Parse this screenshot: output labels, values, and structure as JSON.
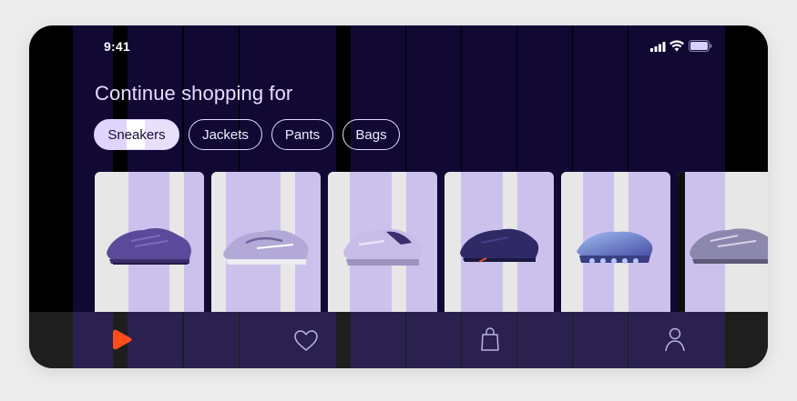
{
  "status_bar": {
    "time": "9:41",
    "icons": [
      "cellular-signal-icon",
      "wifi-icon",
      "battery-icon"
    ]
  },
  "heading": "Continue shopping for",
  "categories": [
    {
      "label": "Sneakers",
      "selected": true
    },
    {
      "label": "Jackets",
      "selected": false
    },
    {
      "label": "Pants",
      "selected": false
    },
    {
      "label": "Bags",
      "selected": false
    }
  ],
  "products": [
    {
      "name": "product-1",
      "image": "purple-sneaker-image"
    },
    {
      "name": "product-2",
      "image": "lilac-running-sneaker-image"
    },
    {
      "name": "product-3",
      "image": "chunky-lavender-sneaker-image"
    },
    {
      "name": "product-4",
      "image": "dark-navy-sneaker-image"
    },
    {
      "name": "product-5",
      "image": "blue-gradient-sneaker-image"
    },
    {
      "name": "product-6",
      "image": "metallic-silver-sneaker-image"
    }
  ],
  "tab_bar": {
    "items": [
      {
        "icon": "brand-logo-icon",
        "active": true
      },
      {
        "icon": "heart-icon",
        "active": false
      },
      {
        "icon": "shopping-bag-icon",
        "active": false
      },
      {
        "icon": "profile-icon",
        "active": false
      }
    ]
  },
  "colors": {
    "background_dark": "#110934",
    "accent_brand": "#ff4d1a",
    "lavender": "#cfc2ee",
    "tab_bar": "#1e1e1e"
  }
}
